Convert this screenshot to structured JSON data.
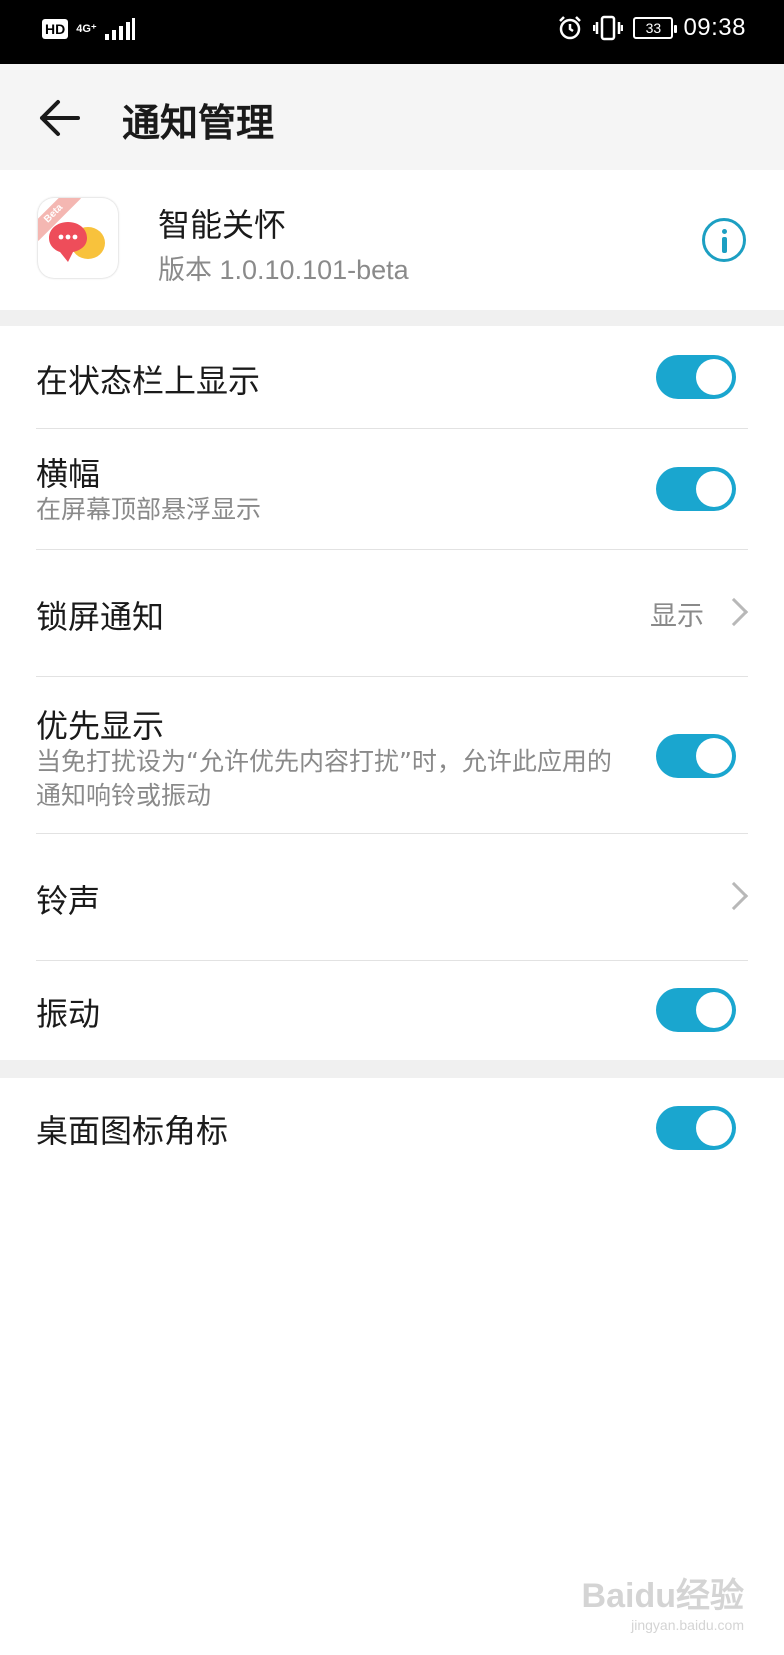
{
  "status_bar": {
    "hd": "HD",
    "network": "4G⁺",
    "battery": "33",
    "time": "09:38",
    "icons": [
      "signal-icon",
      "alarm-icon",
      "vibrate-icon",
      "battery-icon"
    ]
  },
  "header": {
    "title": "通知管理",
    "back_icon": "arrow-left-icon"
  },
  "app": {
    "name": "智能关怀",
    "version": "版本 1.0.10.101-beta",
    "badge": "Beta",
    "info_icon": "info-icon"
  },
  "settings": [
    {
      "label": "在状态栏上显示",
      "toggle": true
    },
    {
      "label": "横幅",
      "subtitle": "在屏幕顶部悬浮显示",
      "toggle": true
    },
    {
      "label": "锁屏通知",
      "value": "显示"
    },
    {
      "label": "优先显示",
      "subtitle": "当免打扰设为“允许优先内容打扰”时，允许此应用的通知响铃或振动",
      "toggle": true
    },
    {
      "label": "铃声"
    },
    {
      "label": "振动",
      "toggle": true
    },
    {
      "label": "桌面图标角标",
      "toggle": true
    }
  ],
  "watermark": {
    "logo": "Baidu经验",
    "url": "jingyan.baidu.com"
  },
  "colors": {
    "accent": "#1aa6cf",
    "info": "#1c9fc2",
    "header_bg": "#f5f5f5",
    "status_bar_bg": "#000000"
  }
}
